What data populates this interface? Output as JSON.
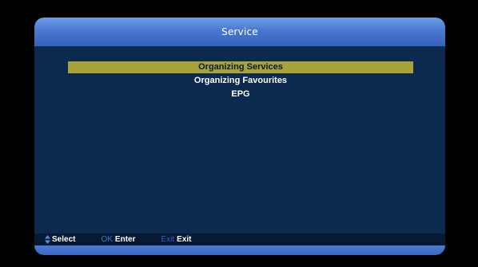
{
  "header": {
    "title": "Service"
  },
  "menu": {
    "items": [
      {
        "label": "Organizing Services",
        "selected": true
      },
      {
        "label": "Organizing Favourites",
        "selected": false
      },
      {
        "label": "EPG",
        "selected": false
      }
    ]
  },
  "helpbar": {
    "select": {
      "icon": "up-down-arrows-icon",
      "label": "Select"
    },
    "enter": {
      "key": "OK",
      "label": "Enter"
    },
    "exit": {
      "key": "Exit",
      "label": "Exit"
    }
  },
  "colors": {
    "panel_bg": "#0c2a4d",
    "title_bar": "#4a78cf",
    "highlight": "#a7a338",
    "key_blue": "#3a6fc9"
  }
}
